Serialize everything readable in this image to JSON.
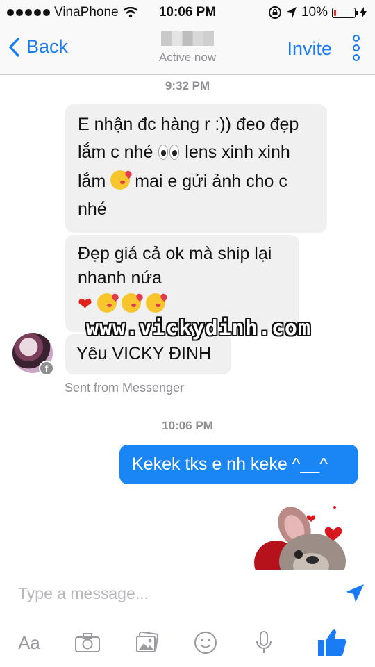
{
  "status_bar": {
    "carrier": "VinaPhone",
    "time": "10:06 PM",
    "battery": "10%",
    "battery_level": 0.1,
    "icons": [
      "signal-dots",
      "wifi-icon",
      "rotation-lock-icon",
      "location-icon",
      "battery-icon",
      "charging-bolt-icon"
    ]
  },
  "nav": {
    "back_label": "Back",
    "status": "Active now",
    "invite_label": "Invite",
    "accent": "#1a7cf5"
  },
  "chat": {
    "timestamp_1": "9:32 PM",
    "msg1": {
      "line1": "E nhận đc hàng r :)) đeo đẹp",
      "line2a": "lắm c nhé",
      "line2b": "lens xinh xinh",
      "line3a": "lắm",
      "line3b": "mai e gửi ảnh cho c",
      "line4": "nhé"
    },
    "msg2": {
      "line1": "Đẹp giá cả ok mà ship lại",
      "line2": "nhanh nứa",
      "heart": "❤"
    },
    "msg3": "Yêu VICKY ĐINH",
    "sent_from": "Sent from Messenger",
    "fb_badge": "f",
    "timestamp_2": "10:06 PM",
    "outgoing": "Kekek tks e nh keke ^__^",
    "outgoing_color": "#1a86f5"
  },
  "watermark": "www.vickydinh.com",
  "composer": {
    "placeholder": "Type a message...",
    "aa_label": "Aa",
    "toolbar_icons": [
      "aa-icon",
      "camera-icon",
      "photos-icon",
      "emoji-icon",
      "microphone-icon",
      "thumbs-up-icon"
    ],
    "like_color": "#1a7cf5"
  }
}
